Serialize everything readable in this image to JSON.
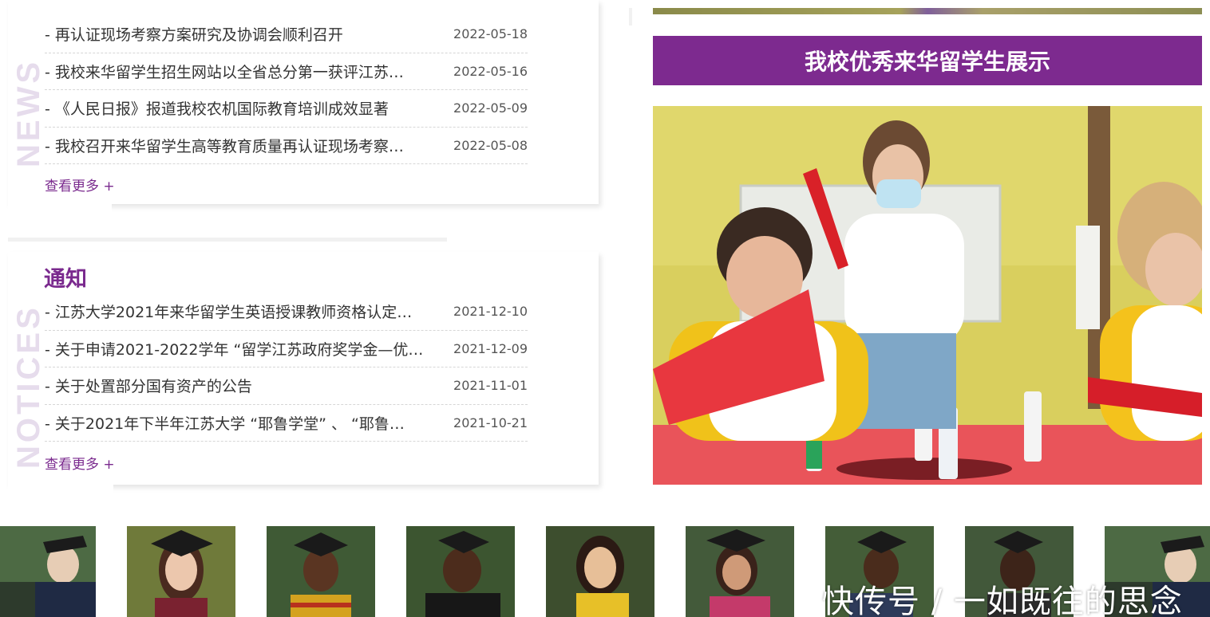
{
  "news": {
    "watermark": "NEWS",
    "items": [
      {
        "title": "- 再认证现场考察方案研究及协调会顺利召开",
        "date": "2022-05-18"
      },
      {
        "title": "- 我校来华留学生招生网站以全省总分第一获评江苏…",
        "date": "2022-05-16"
      },
      {
        "title": "- 《人民日报》报道我校农机国际教育培训成效显著",
        "date": "2022-05-09"
      },
      {
        "title": "- 我校召开来华留学生高等教育质量再认证现场考察…",
        "date": "2022-05-08"
      }
    ],
    "more_label": "查看更多 +"
  },
  "notice": {
    "title": "通知",
    "watermark": "NOTICES",
    "items": [
      {
        "title": "- 江苏大学2021年来华留学生英语授课教师资格认定…",
        "date": "2021-12-10"
      },
      {
        "title": "- 关于申请2021-2022学年 “留学江苏政府奖学金—优…",
        "date": "2021-12-09"
      },
      {
        "title": "- 关于处置部分国有资产的公告",
        "date": "2021-11-01"
      },
      {
        "title": "- 关于2021年下半年江苏大学 “耶鲁学堂” 、 “耶鲁…",
        "date": "2021-10-21"
      }
    ],
    "more_label": "查看更多 +"
  },
  "showcase": {
    "title": "我校优秀来华留学生展示",
    "accent_color": "#7d2a8f"
  },
  "gallery": {
    "thumbs": [
      {
        "name": "student-1"
      },
      {
        "name": "student-2"
      },
      {
        "name": "student-3"
      },
      {
        "name": "student-4"
      },
      {
        "name": "student-5"
      },
      {
        "name": "student-6"
      },
      {
        "name": "student-7"
      },
      {
        "name": "student-8"
      },
      {
        "name": "student-9"
      }
    ]
  },
  "overlay_watermark": "快传号 / 一如既往的思念"
}
